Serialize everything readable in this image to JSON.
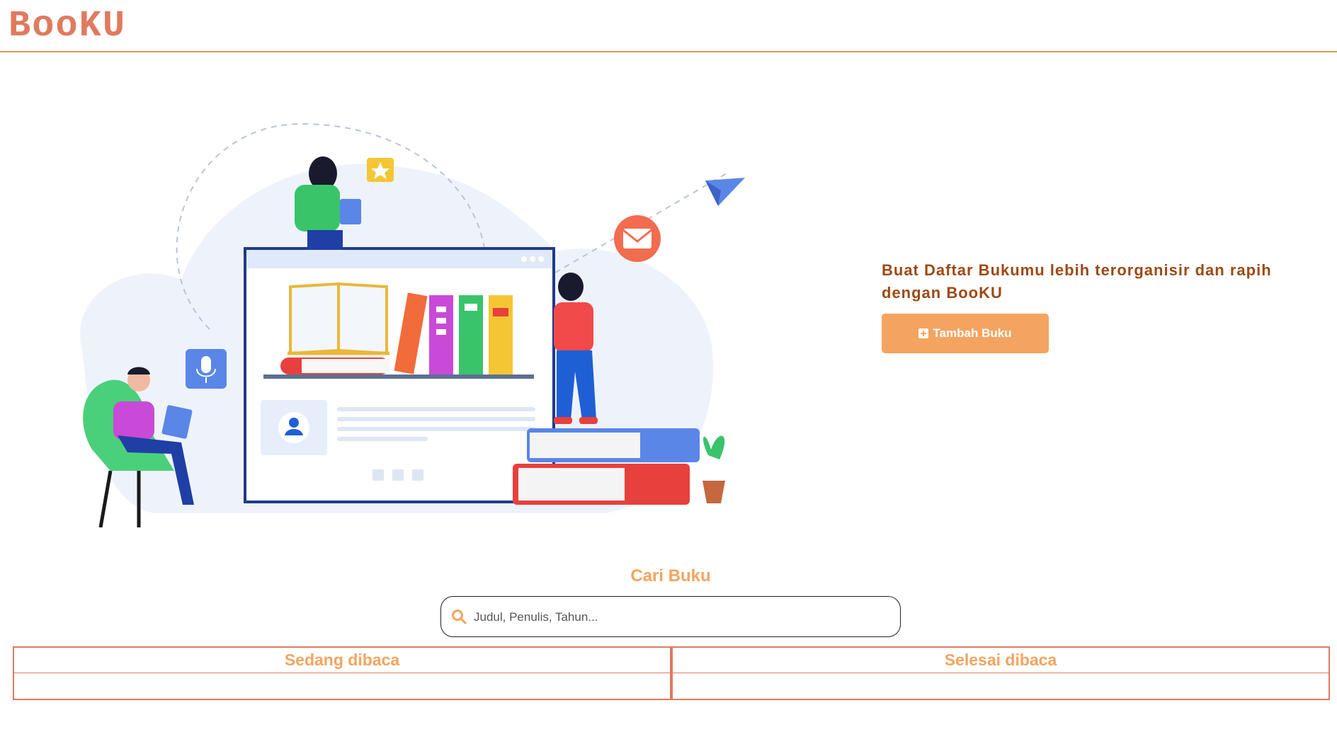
{
  "app": {
    "logo": "BooKU"
  },
  "hero": {
    "tagline": "Buat Daftar Bukumu lebih terorganisir dan rapih dengan BooKU",
    "add_button_label": "Tambah Buku",
    "add_button_icon": "plus-square-icon"
  },
  "search": {
    "title": "Cari Buku",
    "placeholder": "Judul, Penulis, Tahun...",
    "value": "",
    "icon": "search-icon"
  },
  "shelves": [
    {
      "label": "Sedang dibaca"
    },
    {
      "label": "Selesai dibaca"
    }
  ],
  "colors": {
    "brand": "#e07a5f",
    "accent": "#f4a460",
    "tagline": "#9c4a16",
    "header_border": "#e09a5a"
  }
}
